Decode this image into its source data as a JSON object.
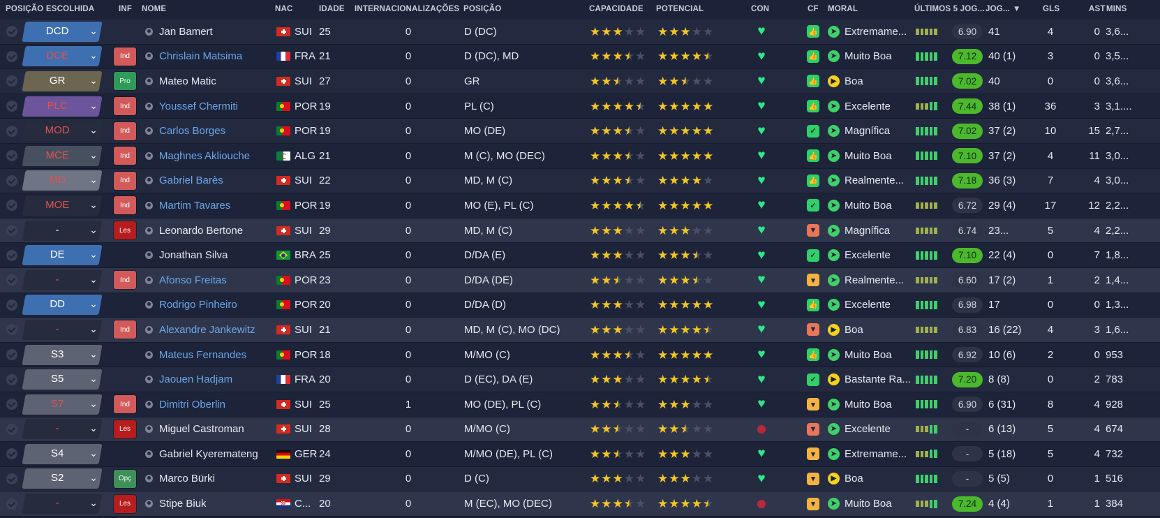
{
  "headers": {
    "pos": "POSIÇÃO ESCOLHIDA",
    "inf": "INF",
    "name": "NOME",
    "nac": "NAC",
    "age": "IDADE",
    "caps": "INTERNACIONALIZAÇÕES",
    "posi": "POSIÇÃO",
    "cap": "CAPACIDADE",
    "pot": "POTENCIAL",
    "con": "CON",
    "cf": "CF",
    "moral": "MORAL",
    "form": "ÚLTIMOS 5 JOG...",
    "jog": "JOG...",
    "sort_icon": "▼",
    "gls": "GLS",
    "ast": "AST",
    "mins": "MINS"
  },
  "colors": {
    "bg": "#1c2237",
    "link": "#6aa6e8",
    "star": "#f4c623",
    "rating_good": "#4cb82c"
  },
  "players": [
    {
      "pos": "DCD",
      "pos_color": "#3e6fb0",
      "pos_text": "#ffffff",
      "inf": "",
      "name": "Jan Bamert",
      "link": false,
      "flag": "ch",
      "nac": "SUI",
      "age": "25",
      "caps": "0",
      "position": "D (DC)",
      "cap": 3,
      "pot": 3,
      "cf": "up",
      "moral_icon": "rocket",
      "moral": "Extremame...",
      "form": "lllll",
      "rating": "6.90",
      "rating_good": false,
      "jog": "41",
      "gls": "4",
      "ast": "0",
      "mins": "3,6..."
    },
    {
      "pos": "DCE",
      "pos_color": "#3e6fb0",
      "pos_text": "#e35050",
      "inf": "Ind",
      "name": "Chrislain Matsima",
      "link": true,
      "flag": "fr",
      "nac": "FRA",
      "age": "21",
      "caps": "0",
      "position": "D (DC), MD",
      "cap": 3.5,
      "pot": 4.5,
      "cf": "up",
      "moral_icon": "rocket",
      "moral": "Muito Boa",
      "form": "hhhhh",
      "rating": "7.12",
      "rating_good": true,
      "jog": "40 (1)",
      "gls": "3",
      "ast": "0",
      "mins": "3,5..."
    },
    {
      "pos": "GR",
      "pos_color": "#6c6650",
      "pos_text": "#ffffff",
      "inf": "Pro",
      "name": "Mateo Matic",
      "link": false,
      "flag": "ch",
      "nac": "SUI",
      "age": "27",
      "caps": "0",
      "position": "GR",
      "cap": 2.5,
      "pot": 2.5,
      "cf": "up",
      "moral_icon": "play",
      "moral": "Boa",
      "form": "hhhhh",
      "rating": "7.02",
      "rating_good": true,
      "jog": "40",
      "gls": "0",
      "ast": "0",
      "mins": "3,6..."
    },
    {
      "pos": "PLC",
      "pos_color": "#6c559a",
      "pos_text": "#e35050",
      "inf": "Ind",
      "name": "Youssef Chermiti",
      "link": true,
      "flag": "pt",
      "nac": "POR",
      "age": "19",
      "caps": "0",
      "position": "PL (C)",
      "cap": 4.5,
      "pot": 5,
      "cf": "up",
      "moral_icon": "rocket",
      "moral": "Excelente",
      "form": "lllhh",
      "rating": "7.44",
      "rating_good": true,
      "jog": "38 (1)",
      "gls": "36",
      "ast": "3",
      "mins": "3,1...."
    },
    {
      "pos": "MOD",
      "pos_color": "#262c3e",
      "pos_text": "#e35050",
      "inf": "Ind",
      "name": "Carlos Borges",
      "link": true,
      "flag": "pt",
      "nac": "POR",
      "age": "19",
      "caps": "0",
      "position": "MO (DE)",
      "cap": 3.5,
      "pot": 5,
      "cf": "check",
      "moral_icon": "rocket",
      "moral": "Magnífica",
      "form": "hhhhh",
      "rating": "7.02",
      "rating_good": true,
      "jog": "37 (2)",
      "gls": "10",
      "ast": "15",
      "mins": "2,7..."
    },
    {
      "pos": "MCE",
      "pos_color": "#46505f",
      "pos_text": "#e35050",
      "inf": "Ind",
      "name": "Maghnes Akliouche",
      "link": true,
      "flag": "dz",
      "nac": "ALG",
      "age": "21",
      "caps": "0",
      "position": "M (C), MO (DEC)",
      "cap": 3.5,
      "pot": 5,
      "cf": "up",
      "moral_icon": "rocket",
      "moral": "Muito Boa",
      "form": "hhhhh",
      "rating": "7.10",
      "rating_good": true,
      "jog": "37 (2)",
      "gls": "4",
      "ast": "11",
      "mins": "3,0..."
    },
    {
      "pos": "MD",
      "pos_color": "#6e7585",
      "pos_text": "#e35050",
      "inf": "Ind",
      "name": "Gabriel Barès",
      "link": true,
      "flag": "ch",
      "nac": "SUI",
      "age": "22",
      "caps": "0",
      "position": "MD, M (C)",
      "cap": 3.5,
      "pot": 4,
      "cf": "up",
      "moral_icon": "rocket",
      "moral": "Realmente...",
      "form": "hhhhh",
      "rating": "7.18",
      "rating_good": true,
      "jog": "36 (3)",
      "gls": "7",
      "ast": "4",
      "mins": "3,0..."
    },
    {
      "pos": "MOE",
      "pos_color": "#262c3e",
      "pos_text": "#e35050",
      "inf": "Ind",
      "name": "Martim Tavares",
      "link": true,
      "flag": "pt",
      "nac": "POR",
      "age": "19",
      "caps": "0",
      "position": "MO (E), PL (C)",
      "cap": 4.5,
      "pot": 5,
      "cf": "check",
      "moral_icon": "rocket",
      "moral": "Muito Boa",
      "form": "lllll",
      "rating": "6.72",
      "rating_good": false,
      "jog": "29 (4)",
      "gls": "17",
      "ast": "12",
      "mins": "2,2..."
    },
    {
      "pos": "-",
      "pos_color": "#262c3e",
      "pos_text": "#ffffff",
      "inf": "Les",
      "name": "Leonardo Bertone",
      "link": false,
      "flag": "ch",
      "nac": "SUI",
      "age": "29",
      "caps": "0",
      "position": "MD, M (C)",
      "cap": 3,
      "pot": 3,
      "cf": "down",
      "moral_icon": "rocket",
      "moral": "Magnífica",
      "form": "lllll",
      "rating": "6.74",
      "rating_good": false,
      "jog": "23...",
      "gls": "5",
      "ast": "4",
      "mins": "2,2..."
    },
    {
      "pos": "DE",
      "pos_color": "#3e6fb0",
      "pos_text": "#ffffff",
      "inf": "",
      "name": "Jonathan Silva",
      "link": false,
      "flag": "br",
      "nac": "BRA",
      "age": "25",
      "caps": "0",
      "position": "D/DA (E)",
      "cap": 3,
      "pot": 3.5,
      "cf": "check",
      "moral_icon": "rocket",
      "moral": "Excelente",
      "form": "hhhhh",
      "rating": "7.10",
      "rating_good": true,
      "jog": "22 (4)",
      "gls": "0",
      "ast": "7",
      "mins": "1,8..."
    },
    {
      "pos": "-",
      "pos_color": "#262c3e",
      "pos_text": "#e35050",
      "inf": "Ind",
      "name": "Afonso Freitas",
      "link": true,
      "flag": "pt",
      "nac": "POR",
      "age": "23",
      "caps": "0",
      "position": "D/DA (DE)",
      "cap": 2.5,
      "pot": 3.5,
      "cf": "warn",
      "moral_icon": "rocket",
      "moral": "Realmente...",
      "form": "lllll",
      "rating": "6.60",
      "rating_good": false,
      "jog": "17 (2)",
      "gls": "1",
      "ast": "2",
      "mins": "1,4..."
    },
    {
      "pos": "DD",
      "pos_color": "#3e6fb0",
      "pos_text": "#ffffff",
      "inf": "",
      "name": "Rodrigo Pinheiro",
      "link": true,
      "flag": "pt",
      "nac": "POR",
      "age": "20",
      "caps": "0",
      "position": "D/DA (D)",
      "cap": 3,
      "pot": 5,
      "cf": "up",
      "moral_icon": "rocket",
      "moral": "Excelente",
      "form": "hhhhh",
      "rating": "6.98",
      "rating_good": false,
      "jog": "17",
      "gls": "0",
      "ast": "0",
      "mins": "1,3..."
    },
    {
      "pos": "-",
      "pos_color": "#262c3e",
      "pos_text": "#e35050",
      "inf": "Ind",
      "name": "Alexandre Jankewitz",
      "link": true,
      "flag": "ch",
      "nac": "SUI",
      "age": "21",
      "caps": "0",
      "position": "MD, M (C), MO (DC)",
      "cap": 3,
      "pot": 4.5,
      "cf": "down",
      "moral_icon": "play",
      "moral": "Boa",
      "form": "lllll",
      "rating": "6.83",
      "rating_good": false,
      "jog": "16 (22)",
      "gls": "4",
      "ast": "3",
      "mins": "1,6..."
    },
    {
      "pos": "S3",
      "pos_color": "#5d6372",
      "pos_text": "#ffffff",
      "inf": "",
      "name": "Mateus Fernandes",
      "link": true,
      "flag": "pt",
      "nac": "POR",
      "age": "18",
      "caps": "0",
      "position": "M/MO (C)",
      "cap": 3.5,
      "pot": 5,
      "cf": "up",
      "moral_icon": "rocket",
      "moral": "Muito Boa",
      "form": "hhhhh",
      "rating": "6.92",
      "rating_good": false,
      "jog": "10 (6)",
      "gls": "2",
      "ast": "0",
      "mins": "953"
    },
    {
      "pos": "S5",
      "pos_color": "#5d6372",
      "pos_text": "#ffffff",
      "inf": "",
      "name": "Jaouen Hadjam",
      "link": true,
      "flag": "fr",
      "nac": "FRA",
      "age": "20",
      "caps": "0",
      "position": "D (EC), DA (E)",
      "cap": 3,
      "pot": 4.5,
      "cf": "check",
      "moral_icon": "play",
      "moral": "Bastante Ra...",
      "form": "hhhhh",
      "rating": "7.20",
      "rating_good": true,
      "jog": "8 (8)",
      "gls": "0",
      "ast": "2",
      "mins": "783"
    },
    {
      "pos": "S7",
      "pos_color": "#5d6372",
      "pos_text": "#e35050",
      "inf": "Ind",
      "name": "Dimitri Oberlin",
      "link": true,
      "flag": "ch",
      "nac": "SUI",
      "age": "25",
      "caps": "1",
      "position": "MO (DE), PL (C)",
      "cap": 2.5,
      "pot": 3,
      "cf": "warn",
      "moral_icon": "rocket",
      "moral": "Muito Boa",
      "form": "hhhhh",
      "rating": "6.90",
      "rating_good": false,
      "jog": "6 (31)",
      "gls": "8",
      "ast": "4",
      "mins": "928"
    },
    {
      "pos": "-",
      "pos_color": "#262c3e",
      "pos_text": "#e35050",
      "inf": "Les",
      "name": "Miguel Castroman",
      "link": false,
      "flag": "ch",
      "nac": "SUI",
      "age": "28",
      "caps": "0",
      "position": "M/MO (C)",
      "cap": 2.5,
      "pot": 2.5,
      "cf": "down",
      "moral_icon": "rocket",
      "moral": "Excelente",
      "form": "lllhh",
      "rating": "-",
      "rating_good": false,
      "jog": "6 (13)",
      "gls": "5",
      "ast": "4",
      "mins": "674"
    },
    {
      "pos": "S4",
      "pos_color": "#5d6372",
      "pos_text": "#ffffff",
      "inf": "",
      "name": "Gabriel Kyeremateng",
      "link": false,
      "flag": "de",
      "nac": "GER",
      "age": "24",
      "caps": "0",
      "position": "M/MO (DE), PL (C)",
      "cap": 2.5,
      "pot": 3,
      "cf": "warn",
      "moral_icon": "rocket",
      "moral": "Extremame...",
      "form": "lllhh",
      "rating": "-",
      "rating_good": false,
      "jog": "5 (18)",
      "gls": "5",
      "ast": "4",
      "mins": "732"
    },
    {
      "pos": "S2",
      "pos_color": "#5d6372",
      "pos_text": "#ffffff",
      "inf": "Opç",
      "name": "Marco Bürki",
      "link": false,
      "flag": "ch",
      "nac": "SUI",
      "age": "29",
      "caps": "0",
      "position": "D (C)",
      "cap": 3,
      "pot": 3,
      "cf": "warn",
      "moral_icon": "play",
      "moral": "Boa",
      "form": "hhhhh",
      "rating": "-",
      "rating_good": false,
      "jog": "5 (5)",
      "gls": "0",
      "ast": "1",
      "mins": "516"
    },
    {
      "pos": "-",
      "pos_color": "#262c3e",
      "pos_text": "#e35050",
      "inf": "Les",
      "name": "Stipe Biuk",
      "link": false,
      "flag": "hr",
      "nac": "C...",
      "age": "20",
      "caps": "0",
      "position": "M (EC), MO (DEC)",
      "cap": 3.5,
      "pot": 4.5,
      "cf": "warn",
      "moral_icon": "rocket",
      "moral": "Muito Boa",
      "form": "lllhh",
      "rating": "7.24",
      "rating_good": true,
      "jog": "4 (4)",
      "gls": "1",
      "ast": "1",
      "mins": "384"
    }
  ]
}
